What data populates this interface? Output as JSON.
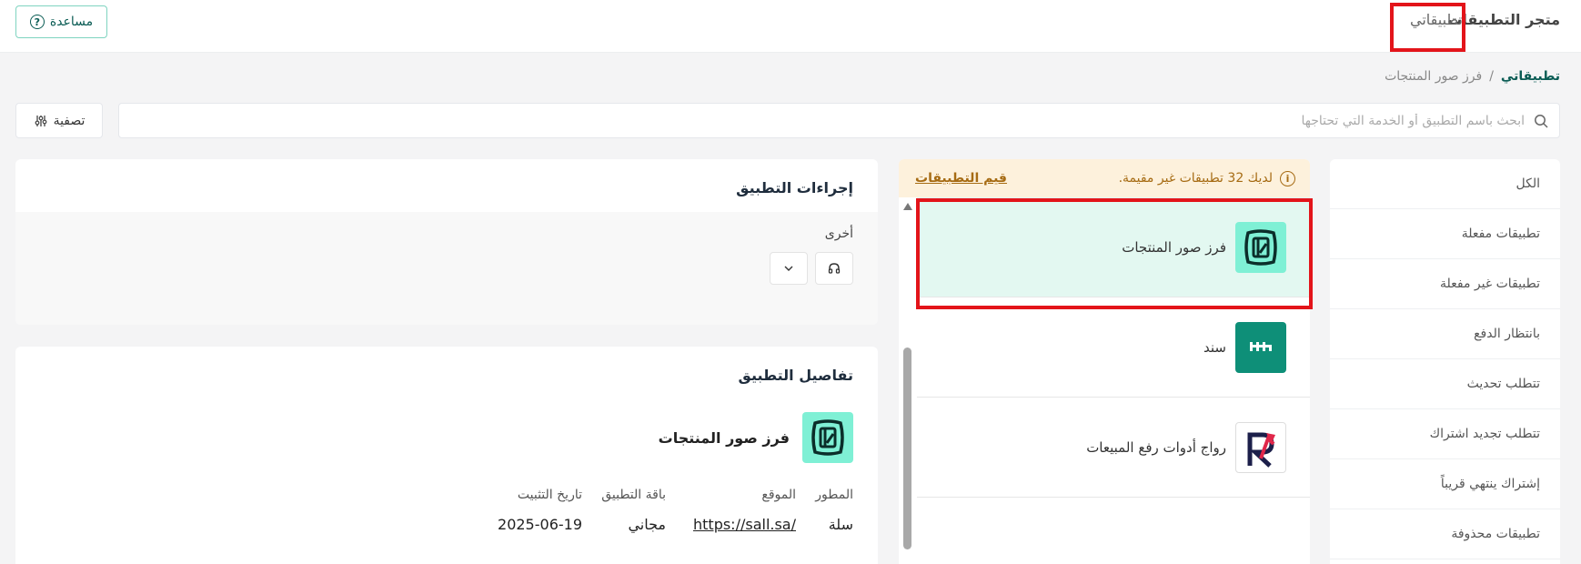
{
  "topbar": {
    "tab_store": "متجر التطبيقات",
    "tab_mine": "تطبيقاتي",
    "help_label": "مساعدة"
  },
  "breadcrumb": {
    "root": "تطبيقاتي",
    "separator": "/",
    "current": "فرز صور المنتجات"
  },
  "search": {
    "placeholder": "ابحث باسم التطبيق أو الخدمة التي تحتاجها",
    "value": ""
  },
  "filter": {
    "label": "تصفية"
  },
  "categories": [
    {
      "label": "الكل"
    },
    {
      "label": "تطبيقات مفعلة"
    },
    {
      "label": "تطبيقات غير مفعلة"
    },
    {
      "label": "بانتظار الدفع"
    },
    {
      "label": "تتطلب تحديث"
    },
    {
      "label": "تتطلب تجديد اشتراك"
    },
    {
      "label": "إشتراك ينتهي قريباً"
    },
    {
      "label": "تطبيقات محذوفة"
    }
  ],
  "notice": {
    "text": "لديك 32 تطبيقات غير مقيمة.",
    "link": "قيم التطبيقات"
  },
  "apps": [
    {
      "name": "فرز صور المنتجات",
      "icon": "product-sort-icon",
      "selected": true
    },
    {
      "name": "سند",
      "icon": "sanad-logo",
      "selected": false
    },
    {
      "name": "رواج أدوات رفع المبيعات",
      "icon": "rawaj-logo",
      "selected": false
    }
  ],
  "actions_card": {
    "title": "إجراءات التطبيق",
    "other_label": "أخرى"
  },
  "details_card": {
    "title": "تفاصيل التطبيق",
    "app_name": "فرز صور المنتجات",
    "labels": {
      "developer": "المطور",
      "website": "الموقع",
      "plan": "باقة التطبيق",
      "install_date": "تاريخ التثبيت"
    },
    "values": {
      "developer": "سلة",
      "website": "https://sall.sa/",
      "plan": "مجاني",
      "install_date": "2025-06-19"
    }
  },
  "colors": {
    "accent": "#0a5c54",
    "selected_bg": "#e3f8f1",
    "highlight_red": "#e3141a",
    "notice_bg": "#fdf1dc",
    "app_icon_bg": "#7ff0d5",
    "sanad_bg": "#0e8f78"
  }
}
